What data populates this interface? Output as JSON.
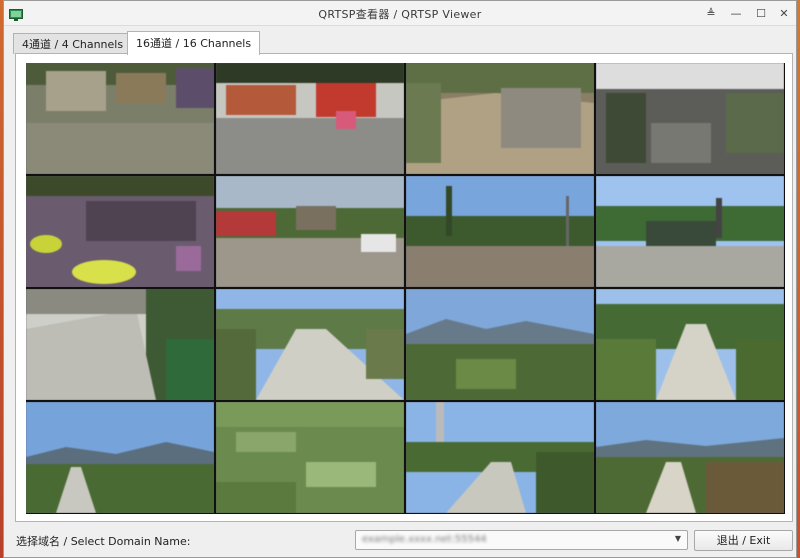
{
  "window": {
    "title": "QRTSP查看器 / QRTSP Viewer",
    "buttons": {
      "pin": "≜",
      "minimize": "—",
      "maximize": "☐",
      "close": "✕"
    }
  },
  "tabs": [
    {
      "label": "4通道 / 4 Channels",
      "active": false
    },
    {
      "label": "16通道 / 16 Channels",
      "active": true
    }
  ],
  "channels": [
    {
      "label": "",
      "time": ""
    },
    {
      "label": "",
      "time": ""
    },
    {
      "label": "",
      "time": ""
    },
    {
      "label": "",
      "time": ""
    },
    {
      "label": "",
      "time": ""
    },
    {
      "label": "",
      "time": ""
    },
    {
      "label": "",
      "time": ""
    },
    {
      "label": "",
      "time": ""
    },
    {
      "label": "",
      "time": ""
    },
    {
      "label": "",
      "time": ""
    },
    {
      "label": "",
      "time": ""
    },
    {
      "label": "",
      "time": ""
    },
    {
      "label": "",
      "time": ""
    },
    {
      "label": "",
      "time": ""
    },
    {
      "label": "",
      "time": ""
    },
    {
      "label": "",
      "time": ""
    }
  ],
  "footer": {
    "domain_label": "选择域名 / Select Domain Name:",
    "domain_value": "example.xxxx.net:55544",
    "exit_label": "退出 / Exit"
  },
  "colors": {
    "sky": "#8fb6e6",
    "foliage": "#4d6a36",
    "ground": "#b9b3a7",
    "window_bg": "#efefef",
    "desktop": "#c96a3a"
  }
}
